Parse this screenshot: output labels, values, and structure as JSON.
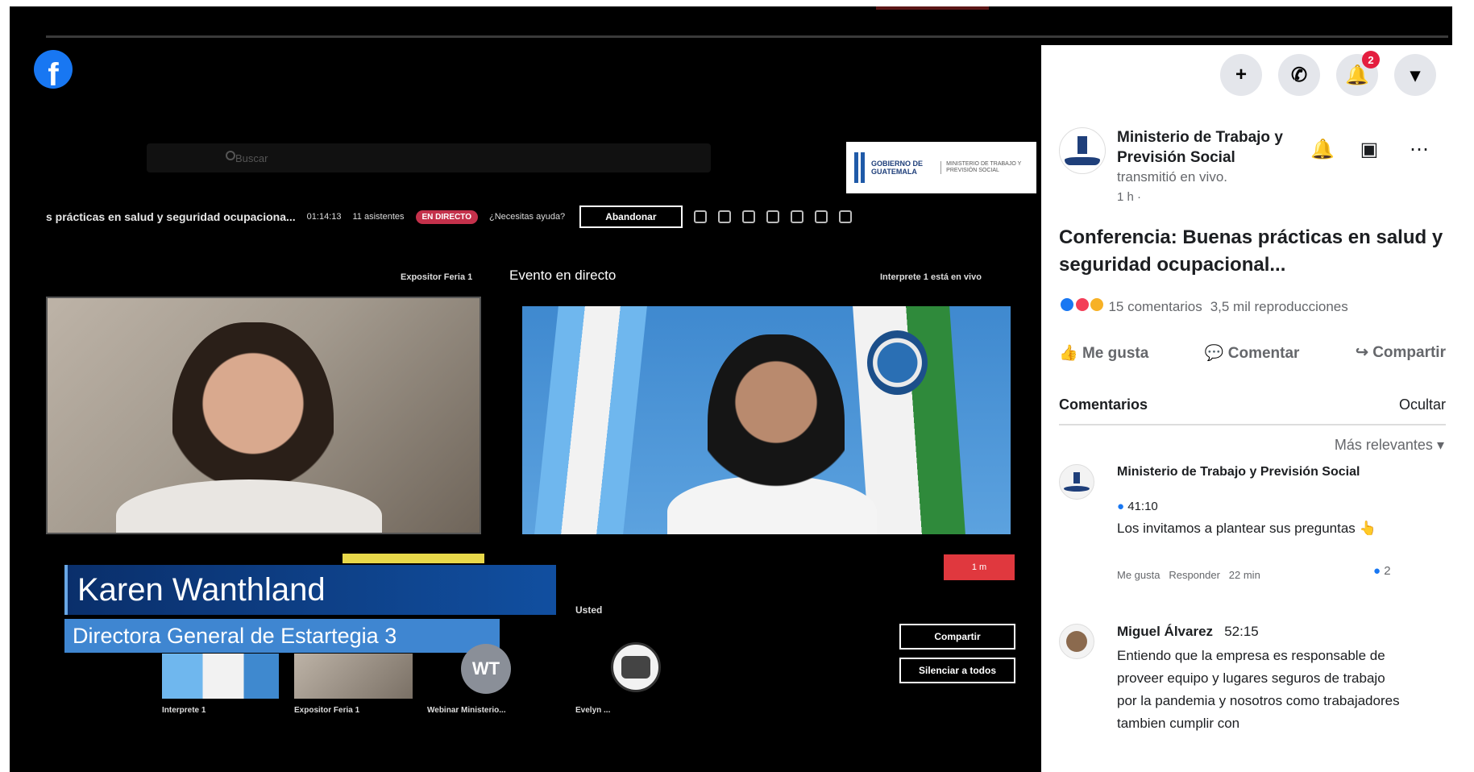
{
  "teams": {
    "search_placeholder": "Buscar",
    "event_title": "s prácticas en salud y seguridad ocupaciona...",
    "elapsed": "01:14:13",
    "attendees": "11 asistentes",
    "live_badge": "EN DIRECTO",
    "help": "¿Necesitas ayuda?",
    "leave_label": "Abandonar",
    "left_pane_label": "Expositor Feria 1",
    "center_pane_label": "Evento en directo",
    "right_pane_label": "Interprete 1 está en vivo",
    "you_label": "Usted",
    "red_badge": "1 m",
    "lower_third_name": "Karen Wanthland",
    "lower_third_role": "Directora General de Estartegia 3",
    "wt_initials": "WT",
    "participants": [
      "Interprete 1",
      "Expositor Feria 1",
      "Webinar Ministerio...",
      "Evelyn ..."
    ],
    "share_label": "Compartir",
    "mute_all_label": "Silenciar a todos"
  },
  "banner": {
    "line1": "GOBIERNO DE GUATEMALA",
    "line2": "MINISTERIO DE TRABAJO Y PREVISIÓN SOCIAL"
  },
  "fb": {
    "logo": "f",
    "notification_count": "2",
    "top_icons": [
      "plus-icon",
      "messenger-icon",
      "bell-icon",
      "caret-down-icon"
    ],
    "page_name": "Ministerio de Trabajo y Previsión Social",
    "status": "transmitió en vivo.",
    "time": "1 h ·",
    "post_title": "Conferencia: Buenas prácticas en salud y seguridad ocupacional...",
    "comments_count": "15 comentarios",
    "views": "3,5 mil reproducciones",
    "like_label": "Me gusta",
    "comment_label": "Comentar",
    "share_label": "Compartir",
    "comments_heading": "Comentarios",
    "hide_label": "Ocultar",
    "sort_label": "Más relevantes",
    "comments": [
      {
        "author": "Ministerio de Trabajo y Previsión Social",
        "timestamp": "41:10",
        "text": "Los invitamos a plantear sus preguntas",
        "like": "Me gusta",
        "reply": "Responder",
        "age": "22 min",
        "reactions": "2"
      },
      {
        "author": "Miguel Álvarez",
        "timestamp": "52:15",
        "text": "Entiendo que la empresa es responsable de proveer equipo y lugares seguros de trabajo por la pandemia y nosotros como trabajadores tambien cumplir con"
      }
    ]
  }
}
